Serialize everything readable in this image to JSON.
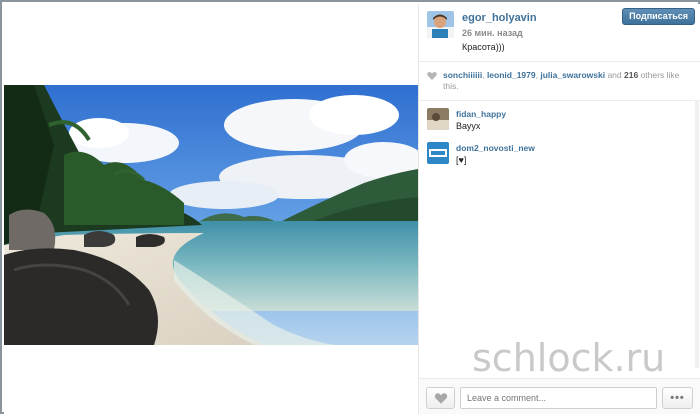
{
  "post": {
    "author": "egor_holyavin",
    "time_ago": "26 мин. назад",
    "caption": "Красота)))",
    "follow_label": "Подписаться"
  },
  "likes": {
    "users": [
      "sonchiiiiii",
      "leonid_1979",
      "julia_swarowski"
    ],
    "and_label": "and",
    "count": "216",
    "suffix": "others like this.",
    "sep1": ", ",
    "sep2": ", "
  },
  "comments": [
    {
      "user": "fidan_happy",
      "text": "Вауух"
    },
    {
      "user": "dom2_novosti_new",
      "text": "[♥]"
    }
  ],
  "footer": {
    "comment_placeholder": "Leave a comment...",
    "more_label": "•••"
  },
  "watermark": "schlock.ru",
  "colors": {
    "link": "#3f729b",
    "follow_button": "#3f729b",
    "frame_border": "#8a949c"
  },
  "icons": {
    "like": "heart-icon",
    "more": "more-dots-icon"
  }
}
